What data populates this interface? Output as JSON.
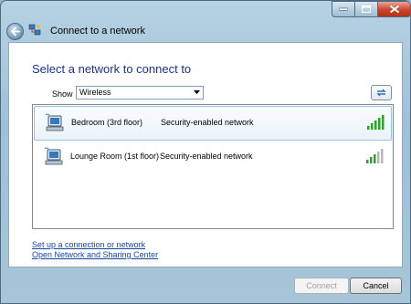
{
  "window": {
    "title": "Connect to a network"
  },
  "main": {
    "heading": "Select a network to connect to",
    "show_label": "Show",
    "show_filter": {
      "selected": "Wireless"
    },
    "networks": [
      {
        "name": "Bedroom (3rd floor)",
        "security": "Security-enabled network",
        "signal_bars": 5,
        "selected": true
      },
      {
        "name": "Lounge Room (1st floor)",
        "security": "Security-enabled network",
        "signal_bars": 3,
        "selected": false
      }
    ],
    "links": [
      "Set up a connection or network",
      "Open Network and Sharing Center"
    ]
  },
  "buttons": {
    "connect": "Connect",
    "cancel": "Cancel"
  },
  "icons": {
    "back": "back-arrow-icon",
    "network": "network-icon",
    "refresh": "refresh-icon",
    "computer": "wireless-computer-icon",
    "signal": "signal-strength-icon"
  },
  "colors": {
    "heading": "#1e3287",
    "link": "#1a47a3",
    "signal_on": "#2ea02e",
    "signal_off": "#b8b8b8"
  }
}
